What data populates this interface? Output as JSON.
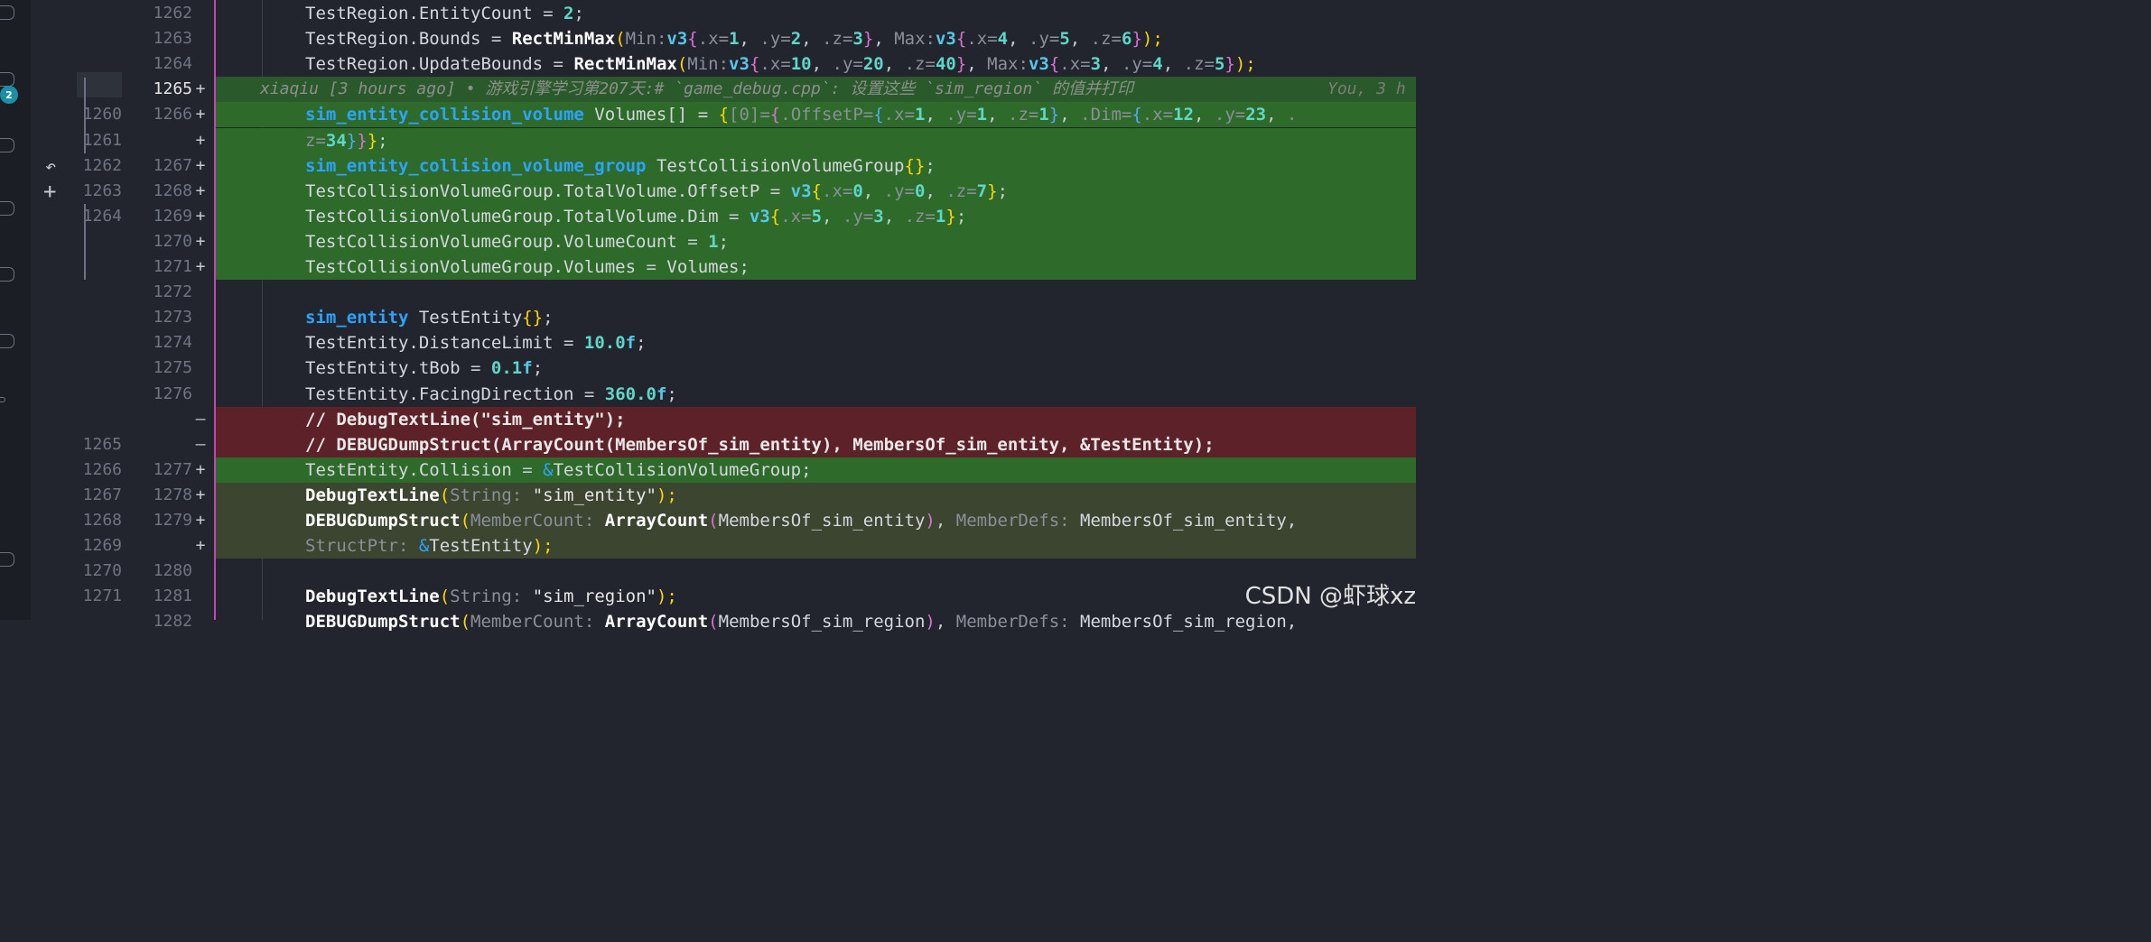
{
  "activity_bar": {
    "badge_count": "2"
  },
  "blame": {
    "text": "xiaqiu [3 hours ago] • 游戏引擎学习第207天:# `game_debug.cpp`: 设置这些 `sim_region` 的值并打印",
    "right": "You, 3 h"
  },
  "lines": [
    {
      "old": "",
      "new": "1262",
      "mark": "",
      "type": "ctx"
    },
    {
      "old": "",
      "new": "1263",
      "mark": "",
      "type": "ctx"
    },
    {
      "old": "",
      "new": "1264",
      "mark": "",
      "type": "ctx"
    },
    {
      "old": "",
      "new": "1265",
      "mark": "+",
      "type": "cur"
    },
    {
      "old": "1260",
      "new": "1266",
      "mark": "+",
      "type": "add"
    },
    {
      "old": "1261",
      "new": "",
      "mark": "+",
      "type": "add"
    },
    {
      "old": "1262",
      "new": "1267",
      "mark": "+",
      "type": "add"
    },
    {
      "old": "1263",
      "new": "1268",
      "mark": "+",
      "type": "add"
    },
    {
      "old": "1264",
      "new": "1269",
      "mark": "+",
      "type": "add"
    },
    {
      "old": "",
      "new": "1270",
      "mark": "+",
      "type": "add"
    },
    {
      "old": "",
      "new": "1271",
      "mark": "+",
      "type": "add"
    },
    {
      "old": "",
      "new": "1272",
      "mark": "",
      "type": "ctx"
    },
    {
      "old": "",
      "new": "1273",
      "mark": "",
      "type": "ctx"
    },
    {
      "old": "",
      "new": "1274",
      "mark": "",
      "type": "ctx"
    },
    {
      "old": "",
      "new": "1275",
      "mark": "",
      "type": "ctx"
    },
    {
      "old": "",
      "new": "1276",
      "mark": "",
      "type": "ctx"
    },
    {
      "old": "",
      "new": "",
      "mark": "—",
      "type": "del"
    },
    {
      "old": "1265",
      "new": "",
      "mark": "—",
      "type": "del"
    },
    {
      "old": "1266",
      "new": "1277",
      "mark": "+",
      "type": "add"
    },
    {
      "old": "1267",
      "new": "1278",
      "mark": "+",
      "type": "mod"
    },
    {
      "old": "1268",
      "new": "1279",
      "mark": "+",
      "type": "mod"
    },
    {
      "old": "1269",
      "new": "",
      "mark": "+",
      "type": "mod"
    },
    {
      "old": "1270",
      "new": "1280",
      "mark": "",
      "type": "ctx"
    },
    {
      "old": "1271",
      "new": "1281",
      "mark": "",
      "type": "ctx"
    },
    {
      "old": "",
      "new": "1282",
      "mark": "",
      "type": "ctx"
    }
  ],
  "code": {
    "l1262": [
      "TestRegion.EntityCount",
      " = ",
      "2",
      ";"
    ],
    "l1263": [
      "TestRegion.Bounds",
      " = ",
      "RectMinMax",
      "(",
      "Min:",
      "v3",
      "{",
      ".x=",
      "1",
      ", ",
      ".y=",
      "2",
      ", ",
      ".z=",
      "3",
      "}",
      ", ",
      "Max:",
      "v3",
      "{",
      ".x=",
      "4",
      ", ",
      ".y=",
      "5",
      ", ",
      ".z=",
      "6",
      "}",
      ");"
    ],
    "l1264": [
      "TestRegion.UpdateBounds",
      " = ",
      "RectMinMax",
      "(",
      "Min:",
      "v3",
      "{",
      ".x=",
      "10",
      ", ",
      ".y=",
      "20",
      ", ",
      ".z=",
      "40",
      "}",
      ", ",
      "Max:",
      "v3",
      "{",
      ".x=",
      "3",
      ", ",
      ".y=",
      "4",
      ", ",
      ".z=",
      "5",
      "}",
      ");"
    ],
    "l1266": [
      "sim_entity_collision_volume",
      " Volumes[] = ",
      "{",
      "[0]=",
      "{",
      ".OffsetP=",
      "{",
      ".x=",
      "1",
      ", ",
      ".y=",
      "1",
      ", ",
      ".z=",
      "1",
      "}",
      ", ",
      ".Dim=",
      "{",
      ".x=",
      "12",
      ", ",
      ".y=",
      "23",
      ", ",
      "."
    ],
    "l1266b": [
      "z=",
      "34",
      "}",
      "}",
      "}",
      ";"
    ],
    "l1267": [
      "sim_entity_collision_volume_group",
      " TestCollisionVolumeGroup",
      "{}",
      ";"
    ],
    "l1268": [
      "TestCollisionVolumeGroup.TotalVolume.OffsetP",
      " = ",
      "v3",
      "{",
      ".x=",
      "0",
      ", ",
      ".y=",
      "0",
      ", ",
      ".z=",
      "7",
      "}",
      ";"
    ],
    "l1269": [
      "TestCollisionVolumeGroup.TotalVolume.Dim",
      " = ",
      "v3",
      "{",
      ".x=",
      "5",
      ", ",
      ".y=",
      "3",
      ", ",
      ".z=",
      "1",
      "}",
      ";"
    ],
    "l1270": [
      "TestCollisionVolumeGroup.VolumeCount",
      " = ",
      "1",
      ";"
    ],
    "l1271": [
      "TestCollisionVolumeGroup.Volumes",
      " = ",
      "Volumes;"
    ],
    "l1273": [
      "sim_entity",
      " TestEntity",
      "{}",
      ";"
    ],
    "l1274": [
      "TestEntity.DistanceLimit",
      " = ",
      "10.0",
      "f",
      ";"
    ],
    "l1275": [
      "TestEntity.tBob",
      " = ",
      "0.1",
      "f",
      ";"
    ],
    "l1276": [
      "TestEntity.FacingDirection",
      " = ",
      "360.0",
      "f",
      ";"
    ],
    "del1": [
      "// DebugTextLine(\"sim_entity\");"
    ],
    "del2": [
      "// DEBUGDumpStruct(ArrayCount(MembersOf_sim_entity), MembersOf_sim_entity, &TestEntity);"
    ],
    "l1277": [
      "TestEntity.Collision",
      " = ",
      "&",
      "TestCollisionVolumeGroup;"
    ],
    "l1278": [
      "DebugTextLine",
      "(",
      "String:",
      " \"sim_entity\"",
      ");"
    ],
    "l1279": [
      "DEBUGDumpStruct",
      "(",
      "MemberCount:",
      " ",
      "ArrayCount",
      "(",
      "MembersOf_sim_entity",
      ")",
      ", ",
      "MemberDefs:",
      " MembersOf_sim_entity,"
    ],
    "l1279b": [
      "StructPtr:",
      " ",
      "&",
      "TestEntity",
      ");"
    ],
    "l1281": [
      "DebugTextLine",
      "(",
      "String:",
      " \"sim_region\"",
      ");"
    ],
    "l1282": [
      "DEBUGDumpStruct",
      "(",
      "MemberCount:",
      " ",
      "ArrayCount",
      "(",
      "MembersOf_sim_region",
      ")",
      ", ",
      "MemberDefs:",
      " MembersOf_sim_region,"
    ]
  },
  "watermark": "CSDN @虾球xz"
}
